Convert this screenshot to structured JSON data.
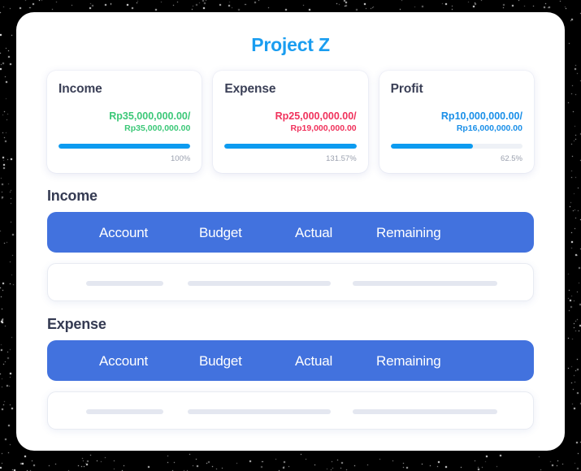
{
  "page": {
    "title": "Project Z",
    "title_color": "#1a9df0",
    "panel_background": "#ffffff",
    "backdrop_color": "#000000"
  },
  "summary_cards": [
    {
      "title": "Income",
      "value_primary": "Rp35,000,000.00/",
      "value_secondary": "Rp35,000,000.00",
      "value_color": "#3cc878",
      "percent_label": "100%",
      "progress_percent": 100,
      "progress_color": "#0d9bf0",
      "track_color": "#eef1f6"
    },
    {
      "title": "Expense",
      "value_primary": "Rp25,000,000.00/",
      "value_secondary": "Rp19,000,000.00",
      "value_color": "#f0325c",
      "percent_label": "131.57%",
      "progress_percent": 100,
      "progress_color": "#0d9bf0",
      "track_color": "#eef1f6"
    },
    {
      "title": "Profit",
      "value_primary": "Rp10,000,000.00/",
      "value_secondary": "Rp16,000,000.00",
      "value_color": "#1a8fe8",
      "percent_label": "62.5%",
      "progress_percent": 62.5,
      "progress_color": "#0d9bf0",
      "track_color": "#eef1f6"
    }
  ],
  "sections": [
    {
      "label": "Income",
      "header_color": "#4272de",
      "columns": [
        "Account",
        "Budget",
        "Actual",
        "Remaining"
      ],
      "rows": [
        {
          "placeholders": 3
        }
      ]
    },
    {
      "label": "Expense",
      "header_color": "#4272de",
      "columns": [
        "Account",
        "Budget",
        "Actual",
        "Remaining"
      ],
      "rows": [
        {
          "placeholders": 3
        }
      ]
    }
  ]
}
